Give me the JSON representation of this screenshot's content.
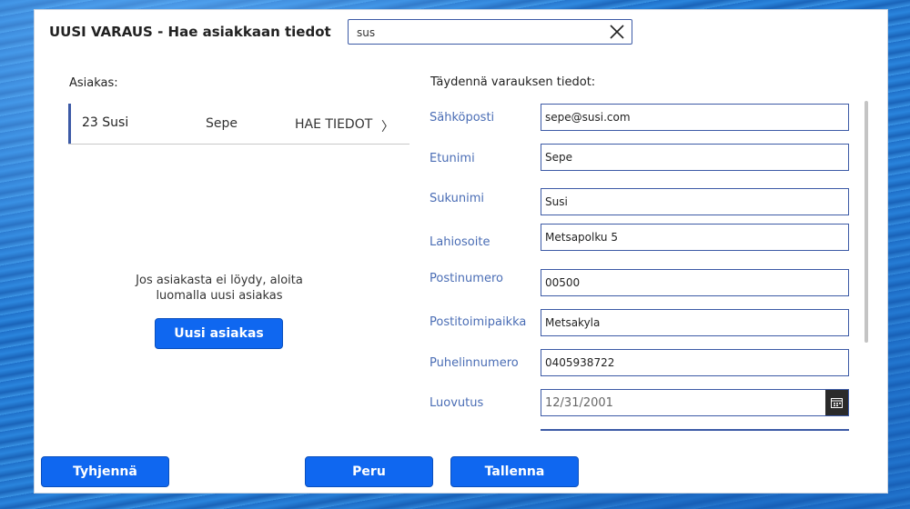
{
  "header": {
    "title": "UUSI VARAUS - Hae asiakkaan tiedot",
    "search_value": "sus"
  },
  "customer": {
    "section_label": "Asiakas:",
    "row": {
      "number_surname": "23 Susi",
      "first_name": "Sepe",
      "action": "HAE TIEDOT",
      "chevron": "〉"
    },
    "no_result_text": "Jos asiakasta ei löydy, aloita luomalla uusi asiakas",
    "new_button": "Uusi asiakas"
  },
  "details": {
    "section_label": "Täydennä varauksen tiedot:",
    "fields": [
      {
        "label": "Sähköposti",
        "value": "sepe@susi.com"
      },
      {
        "label": "Etunimi",
        "value": "Sepe"
      },
      {
        "label": "Sukunimi",
        "value": "Susi"
      },
      {
        "label": "Lahiosoite",
        "value": "Metsapolku 5"
      },
      {
        "label": "Postinumero",
        "value": "00500"
      },
      {
        "label": "Postitoimipaikka",
        "value": "Metsakyla"
      },
      {
        "label": "Puhelinnumero",
        "value": "0405938722"
      },
      {
        "label": "Luovutus",
        "value": "12/31/2001"
      }
    ]
  },
  "footer": {
    "clear": "Tyhjennä",
    "cancel": "Peru",
    "save": "Tallenna"
  },
  "colors": {
    "accent": "#0f67f0",
    "label": "#4a6db5",
    "border": "#3c5aa6"
  },
  "icons": {
    "search_clear": "close-icon",
    "date": "calendar-icon"
  }
}
